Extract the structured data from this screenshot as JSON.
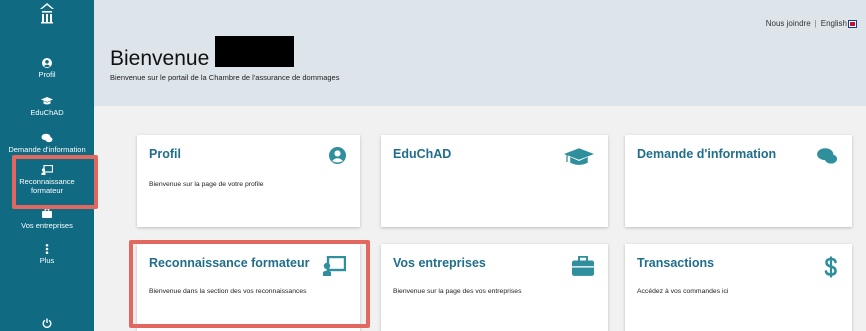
{
  "sidebar": {
    "items": [
      {
        "label": "Profil",
        "icon": "user-circle-icon"
      },
      {
        "label": "EduChAD",
        "icon": "graduation-cap-icon"
      },
      {
        "label": "Demande d'information",
        "icon": "chat-bubbles-icon"
      },
      {
        "label": "Reconnaissance formateur",
        "icon": "chalkboard-teacher-icon"
      },
      {
        "label": "Vos entreprises",
        "icon": "briefcase-icon"
      },
      {
        "label": "Plus",
        "icon": "vertical-ellipsis-icon"
      }
    ],
    "logout_icon": "power-icon"
  },
  "header": {
    "contact_link": "Nous joindre",
    "separator": "|",
    "language_link": "English",
    "welcome_title": "Bienvenue",
    "subtitle": "Bienvenue sur le portail de la Chambre de l'assurance de dommages"
  },
  "cards": [
    {
      "title": "Profil",
      "description": "Bienvenue sur la page de votre profile",
      "icon": "user-circle-icon"
    },
    {
      "title": "EduChAD",
      "description": "",
      "icon": "graduation-cap-icon"
    },
    {
      "title": "Demande d'information",
      "description": "",
      "icon": "chat-bubbles-icon"
    },
    {
      "title": "Reconnaissance formateur",
      "description": "Bienvenue dans la section des vos reconnaissances",
      "icon": "chalkboard-teacher-icon"
    },
    {
      "title": "Vos entreprises",
      "description": "Bienvenue sur la page des vos entreprises",
      "icon": "briefcase-icon"
    },
    {
      "title": "Transactions",
      "description": "Accédez à vos commandes ici",
      "icon": "dollar-icon"
    }
  ],
  "colors": {
    "sidebar_bg": "#0f6a82",
    "accent": "#1f6f8b",
    "card_icon": "#2f8f9d",
    "highlight": "#e2685f",
    "header_bg": "#dde5eb"
  }
}
